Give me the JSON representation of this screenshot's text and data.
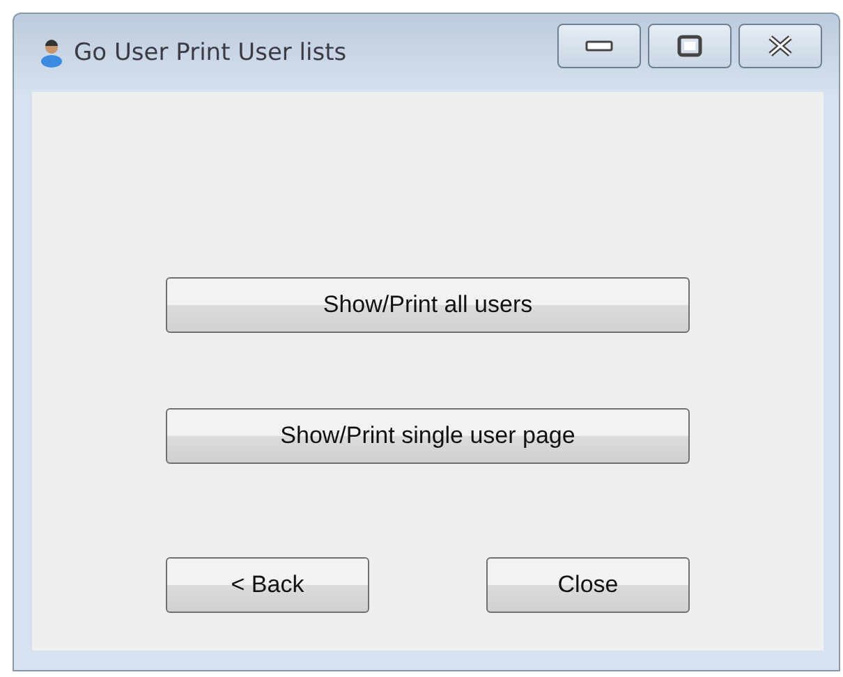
{
  "window": {
    "title": "Go User Print User lists"
  },
  "buttons": [
    "Show/Print all users",
    "Show/Print single user page"
  ],
  "footer_buttons": [
    "< Back",
    "Close"
  ]
}
